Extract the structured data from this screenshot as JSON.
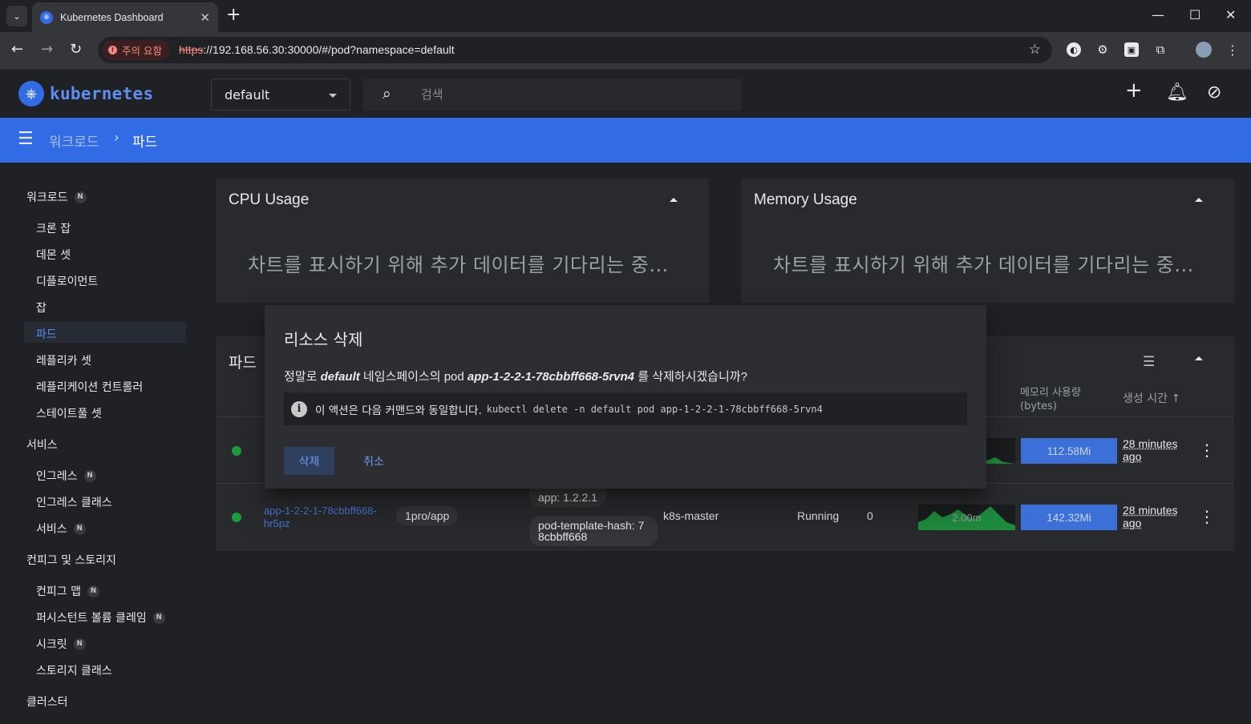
{
  "browser": {
    "tab_title": "Kubernetes Dashboard",
    "security_label": "주의 요함",
    "url_scheme": "https",
    "url_rest": "://192.168.56.30:30000/#/pod?namespace=default"
  },
  "header": {
    "brand": "kubernetes",
    "namespace": "default",
    "search_placeholder": "검색"
  },
  "breadcrumb": {
    "parent": "워크로드",
    "current": "파드"
  },
  "sidebar": {
    "workloads": "워크로드",
    "workload_items": [
      "크론 잡",
      "데몬 셋",
      "디플로이먼트",
      "잡",
      "파드",
      "레플리카 셋",
      "레플리케이션 컨트롤러",
      "스테이트풀 셋"
    ],
    "service": "서비스",
    "service_items": [
      "인그레스",
      "인그레스 클래스",
      "서비스"
    ],
    "config": "컨피그 및 스토리지",
    "config_items": [
      "컨피그 맵",
      "퍼시스턴트 볼륨 클레임",
      "시크릿",
      "스토리지 클래스"
    ],
    "cluster": "클러스터",
    "badge": "N"
  },
  "cpu_card": {
    "title": "CPU Usage",
    "waiting": "차트를 표시하기 위해 추가 데이터를 기다리는 중..."
  },
  "memory_card": {
    "title": "Memory Usage",
    "waiting": "차트를 표시하기 위해 추가 데이터를 기다리는 중..."
  },
  "pods": {
    "title": "파드",
    "col_memory_1": "메모리 사용량",
    "col_memory_2": "(bytes)",
    "col_created": "생성 시간",
    "rows": [
      {
        "memory": "112.58Mi",
        "age_1": "28 minutes",
        "age_2": "ago"
      },
      {
        "name_1": "app-1-2-2-1-78cbbff668-",
        "name_2": "hr5pz",
        "image": "1pro/app",
        "label_1": "app: 1.2.2.1",
        "label_2a": "pod-template-hash: 7",
        "label_2b": "8cbbff668",
        "node": "k8s-master",
        "status": "Running",
        "restarts": "0",
        "cpu": "2.00m",
        "memory": "142.32Mi",
        "age_1": "28 minutes",
        "age_2": "ago"
      }
    ]
  },
  "dialog": {
    "title": "리소스 삭제",
    "msg_prefix": "정말로",
    "namespace": "default",
    "msg_mid": "네임스페이스의 pod",
    "pod_name": "app-1-2-2-1-78cbbff668-5rvn4",
    "msg_suffix": "를 삭제하시겠습니까?",
    "info_text": "이 액션은 다음 커맨드와 동일합니다.",
    "info_cmd": "kubectl delete -n default pod app-1-2-2-1-78cbbff668-5rvn4",
    "delete_label": "삭제",
    "cancel_label": "취소"
  }
}
